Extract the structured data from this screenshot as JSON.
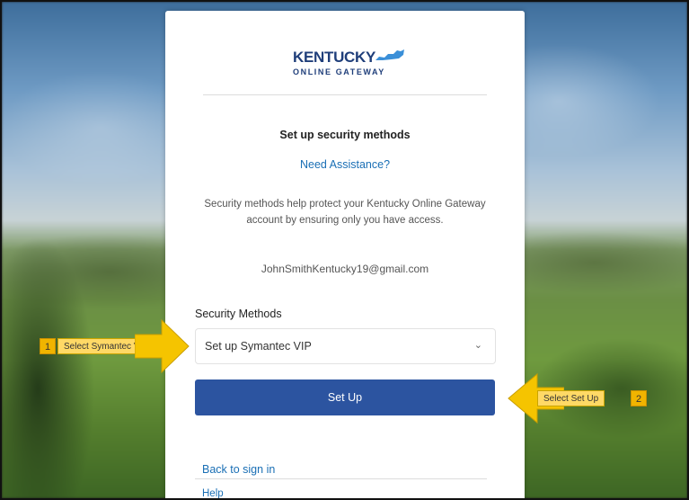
{
  "brand": {
    "title": "KENTUCKY",
    "subtitle": "ONLINE GATEWAY",
    "color": "#1f3e7a"
  },
  "page": {
    "heading": "Set up security methods",
    "assist_link": "Need Assistance?",
    "description": "Security methods help protect your Kentucky Online Gateway account by ensuring only you have access.",
    "email": "JohnSmithKentucky19@gmail.com"
  },
  "form": {
    "methods_label": "Security Methods",
    "selected_method": "Set up Symantec VIP",
    "chevron_icon": "chevron-down-icon",
    "setup_button": "Set Up",
    "setup_button_color": "#2c54a0"
  },
  "footer": {
    "back_link": "Back to sign in",
    "help_link": "Help"
  },
  "annotations": {
    "step1": {
      "number": "1",
      "label": "Select Symantec VIP"
    },
    "step2": {
      "number": "2",
      "label": "Select Set Up"
    },
    "color": "#ffd966"
  }
}
